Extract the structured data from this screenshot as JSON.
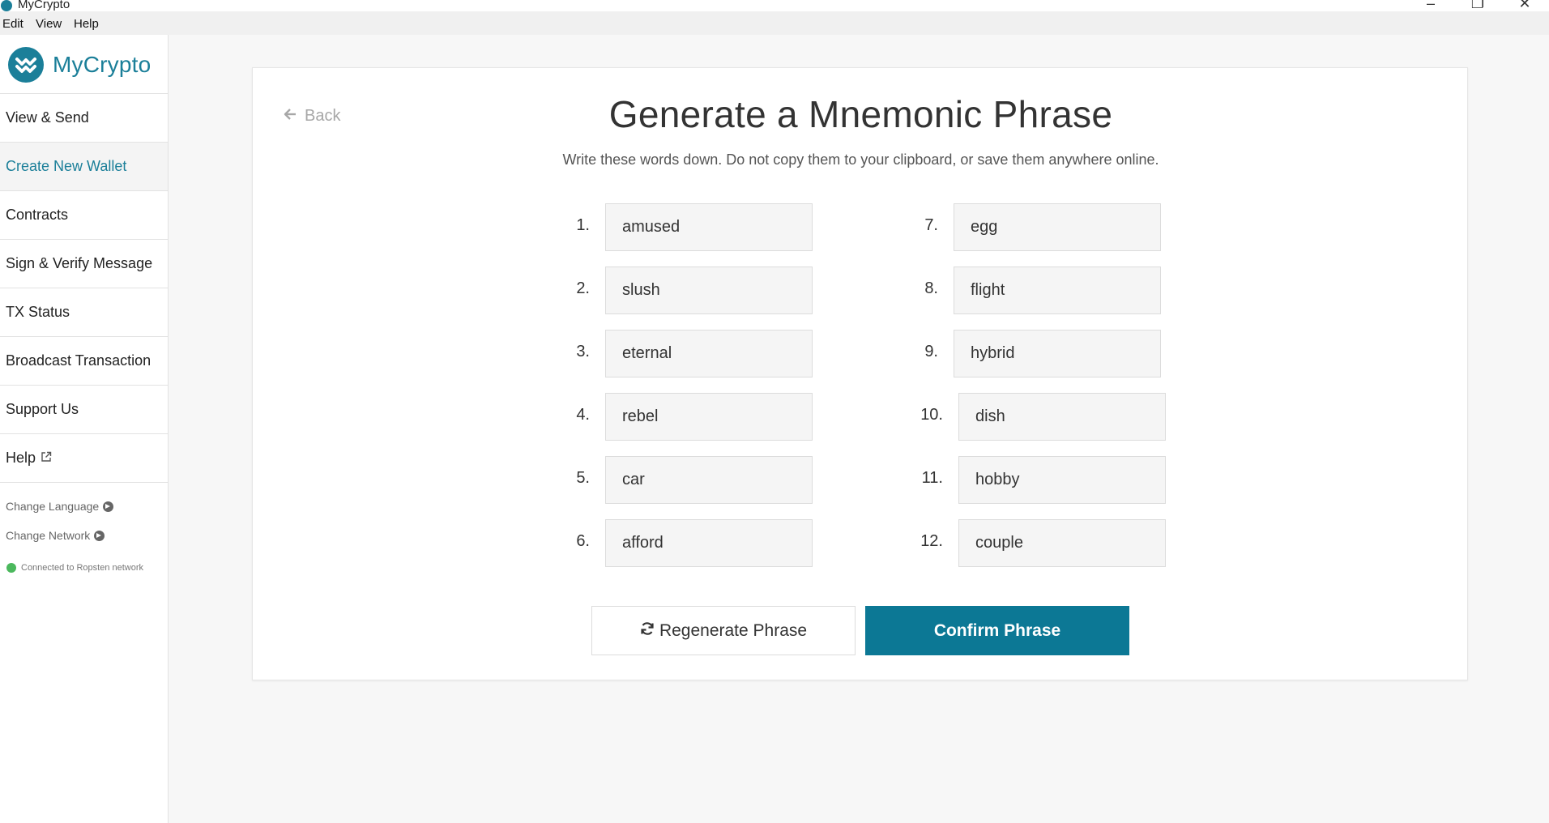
{
  "window": {
    "title": "MyCrypto",
    "controls": {
      "minimize": "–",
      "maximize": "❐",
      "close": "✕"
    }
  },
  "menu": {
    "items": [
      "Edit",
      "View",
      "Help"
    ]
  },
  "sidebar": {
    "logo_text": "MyCrypto",
    "items": [
      {
        "label": "View & Send"
      },
      {
        "label": "Create New Wallet"
      },
      {
        "label": "Contracts"
      },
      {
        "label": "Sign & Verify Message"
      },
      {
        "label": "TX Status"
      },
      {
        "label": "Broadcast Transaction"
      },
      {
        "label": "Support Us"
      },
      {
        "label": "Help"
      }
    ],
    "active_index": 1,
    "change_language": "Change Language",
    "change_network": "Change Network",
    "network_status": "Connected to Ropsten network"
  },
  "main": {
    "back_label": "Back",
    "title": "Generate a Mnemonic Phrase",
    "subtitle": "Write these words down. Do not copy them to your clipboard, or save them anywhere online.",
    "words": [
      {
        "num": "1.",
        "word": "amused"
      },
      {
        "num": "2.",
        "word": "slush"
      },
      {
        "num": "3.",
        "word": "eternal"
      },
      {
        "num": "4.",
        "word": "rebel"
      },
      {
        "num": "5.",
        "word": "car"
      },
      {
        "num": "6.",
        "word": "afford"
      },
      {
        "num": "7.",
        "word": "egg"
      },
      {
        "num": "8.",
        "word": "flight"
      },
      {
        "num": "9.",
        "word": "hybrid"
      },
      {
        "num": "10.",
        "word": "dish"
      },
      {
        "num": "11.",
        "word": "hobby"
      },
      {
        "num": "12.",
        "word": "couple"
      }
    ],
    "regenerate_label": "Regenerate Phrase",
    "confirm_label": "Confirm Phrase"
  },
  "colors": {
    "brand": "#1b7f99",
    "primary_button": "#0c7895",
    "status_ok": "#4bb85d"
  }
}
